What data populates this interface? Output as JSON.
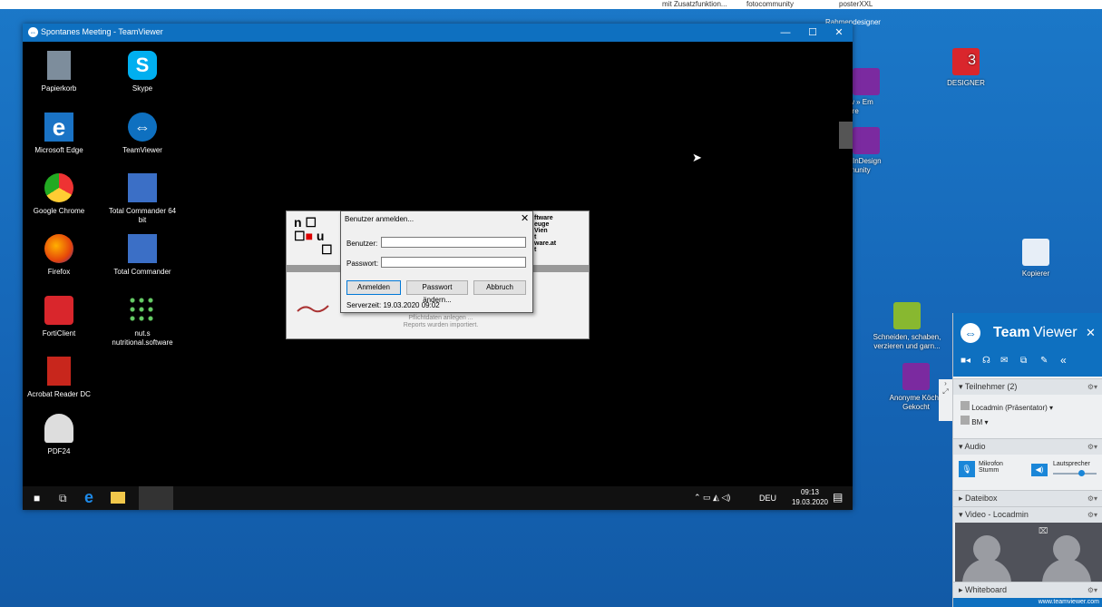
{
  "host_topbar": {
    "item1": "mit Zusatzfunktion...",
    "item2": "fotocommunity",
    "item3": "posterXXL",
    "item4": "Rahmendesigner"
  },
  "host_desktop": {
    "icons": [
      {
        "label": "Flow » Em\nftware"
      },
      {
        "label": "DESIGNER",
        "badge": "3"
      },
      {
        "label": "InDesign\nommunity"
      },
      {
        "label": "Kopierer"
      },
      {
        "label": "Schneiden, schaben,\nverzieren und garn..."
      },
      {
        "label": "Anonyme Köche\nGekocht"
      }
    ]
  },
  "tv_window": {
    "title": "Spontanes Meeting - TeamViewer",
    "min": "—",
    "max": "☐",
    "close": "✕"
  },
  "remote_desktop": {
    "icons": [
      {
        "label": "Papierkorb"
      },
      {
        "label": "Skype"
      },
      {
        "label": "Microsoft Edge"
      },
      {
        "label": "TeamViewer"
      },
      {
        "label": "Google Chrome"
      },
      {
        "label": "Total Commander 64 bit"
      },
      {
        "label": "Firefox"
      },
      {
        "label": "Total Commander"
      },
      {
        "label": "FortiClient"
      },
      {
        "label": "nut.s nutritional.software"
      },
      {
        "label": "Acrobat Reader DC"
      },
      {
        "label": "PDF24"
      }
    ],
    "app_right_text": [
      "ftware",
      "euge",
      "Vien",
      "t",
      "ware.at",
      "t"
    ],
    "app_status": [
      "Pflichtdaten anlegen ...",
      "Reports wurden importiert."
    ]
  },
  "login_dialog": {
    "title": "Benutzer anmelden...",
    "user_label": "Benutzer:",
    "user_value": "",
    "pass_label": "Passwort:",
    "pass_value": "",
    "btn_login": "Anmelden",
    "btn_change": "Passwort ändern...",
    "btn_cancel": "Abbruch",
    "server_time": "Serverzeit: 19.03.2020 09:02"
  },
  "remote_taskbar": {
    "lang": "DEU",
    "time": "09:13",
    "date": "19.03.2020"
  },
  "tv_panel": {
    "brand_bold": "Team",
    "brand_rest": "Viewer",
    "close": "✕",
    "participants_header": "Teilnehmer (2)",
    "participant1": "Locadmin (Präsentator)",
    "participant2": "BM",
    "audio_header": "Audio",
    "mic_label": "Mikrofon\nStumm",
    "speaker_label": "Lautsprecher",
    "filebox_header": "Dateibox",
    "video_header": "Video - Locadmin",
    "whiteboard_header": "Whiteboard",
    "url": "www.teamviewer.com"
  },
  "colors": {
    "tv_blue": "#0e70c0",
    "host_bg": "#1565b6"
  }
}
